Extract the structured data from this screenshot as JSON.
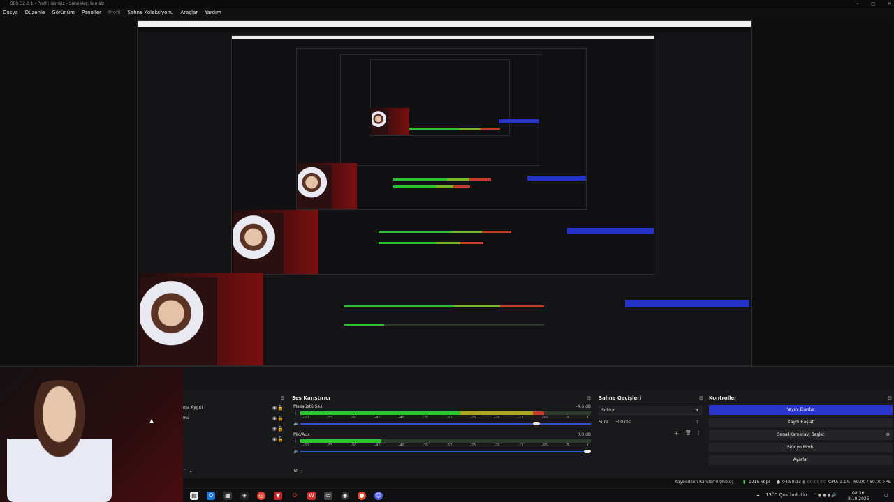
{
  "window": {
    "title": "OBS 32.0.1 - Profil: isimsiz - Sahneler: isimsiz"
  },
  "menu": [
    "Dosya",
    "Düzenle",
    "Görünüm",
    "Paneller",
    "Profil",
    "Sahne Koleksiyonu",
    "Araçlar",
    "Yardım"
  ],
  "docks": {
    "sources": {
      "items": [
        "ma Aygıtı",
        "ma"
      ]
    },
    "mixer": {
      "title": "Ses Karıştırıcı",
      "tracks": [
        {
          "name": "Masaüstü Ses",
          "db": "-4.6 dB",
          "level": 0.84,
          "volume": 0.82
        },
        {
          "name": "Mic/Aux",
          "db": "0.0 dB",
          "level": 0.28,
          "volume": 1.0
        }
      ],
      "ticks": [
        "-60",
        "-55",
        "-50",
        "-45",
        "-40",
        "-35",
        "-30",
        "-25",
        "-20",
        "-15",
        "-10",
        "-5",
        "0"
      ]
    },
    "transitions": {
      "title": "Sahne Geçişleri",
      "type": "Soldur",
      "duration_label": "Süre",
      "duration_value": "300 ms"
    },
    "controls": {
      "title": "Kontroller",
      "buttons": [
        "Yayını Durdur",
        "Kaydı Başlat",
        "Sanal Kamerayı Başlat",
        "Stüdyo Modu",
        "Ayarlar"
      ]
    }
  },
  "status": {
    "dropped": "Kaybedilen Kareler 0 (%0.0)",
    "bitrate": "1215 kbps",
    "stream_time": "04:50:13",
    "record_time": "00:00:00",
    "cpu": "CPU: 2.1%",
    "fps": "60.00 / 60.00 FPS"
  },
  "taskbar": {
    "weather": "13°C Çok bulutlu",
    "time": "08:36",
    "date": "8.10.2025"
  },
  "colors": {
    "accent": "#2a35c9",
    "meter_green": "#2cc233",
    "meter_yellow": "#b0a424",
    "meter_red": "#c63a2a"
  }
}
